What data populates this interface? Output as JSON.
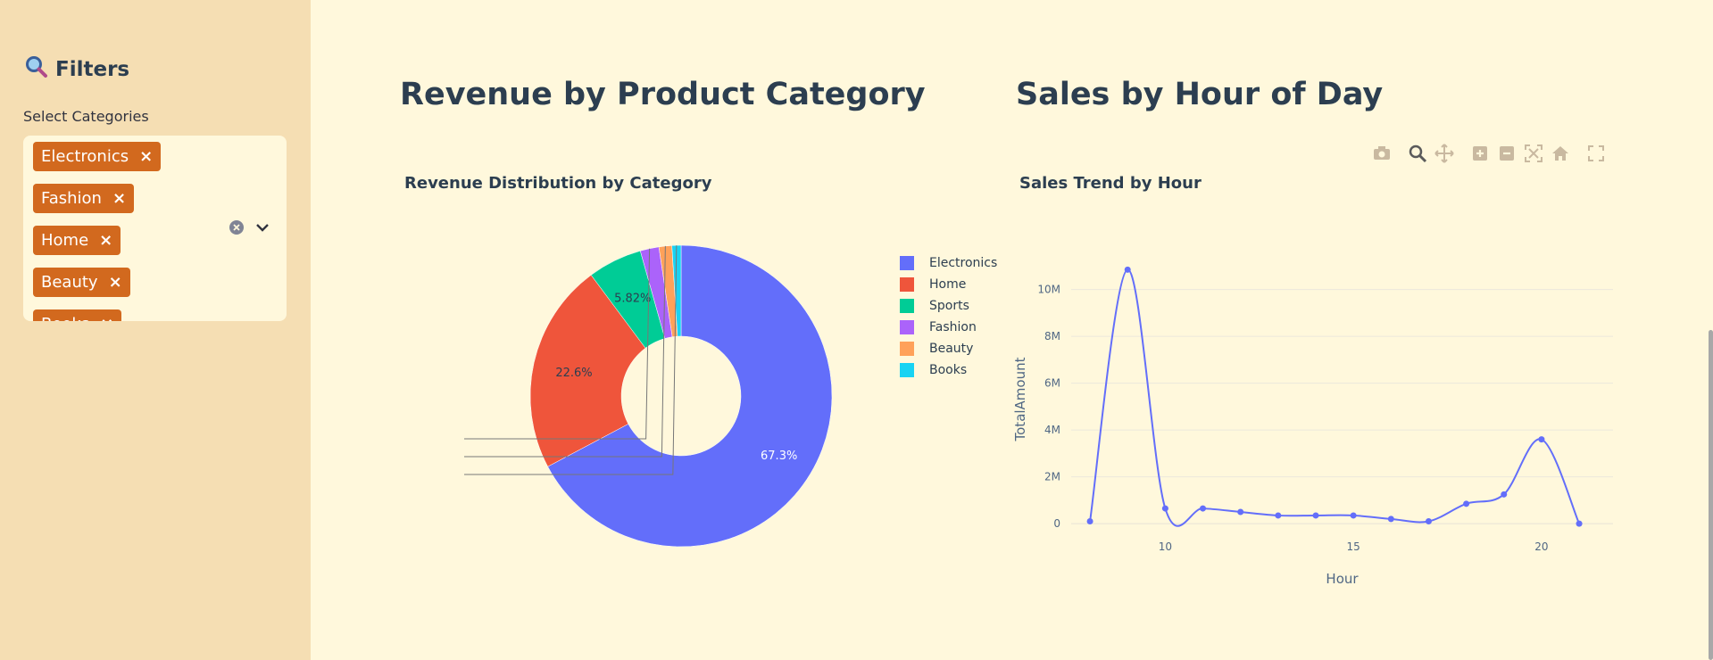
{
  "sidebar": {
    "title": "Filters",
    "select_label": "Select Categories",
    "selected_tags": [
      "Electronics",
      "Fashion",
      "Home",
      "Beauty",
      "Books"
    ],
    "remove_glyph": "×"
  },
  "main": {
    "left_title": "Revenue by Product Category",
    "right_title": "Sales by Hour of Day"
  },
  "icons": {
    "filters": "magnifying-glass-icon",
    "clear": "clear-icon",
    "dropdown": "chevron-down-icon"
  },
  "chart_data": [
    {
      "type": "pie",
      "title": "Revenue Distribution by Category",
      "hole": true,
      "categories": [
        "Electronics",
        "Home",
        "Sports",
        "Fashion",
        "Beauty",
        "Books"
      ],
      "values": [
        67.3,
        22.6,
        5.82,
        2.01,
        1.38,
        0.974
      ],
      "labels": [
        "67.3%",
        "22.6%",
        "5.82%",
        "2.01%",
        "1.38%",
        "0.974%"
      ],
      "colors": [
        "#636efa",
        "#ef553b",
        "#00cc96",
        "#ab63fa",
        "#ffa15a",
        "#19d3f3"
      ],
      "legend": "right"
    },
    {
      "type": "line",
      "title": "Sales Trend by Hour",
      "xlabel": "Hour",
      "ylabel": "TotalAmount",
      "x": [
        8,
        9,
        10,
        11,
        12,
        13,
        14,
        15,
        16,
        17,
        18,
        19,
        20,
        21
      ],
      "y": [
        100000,
        10850000,
        650000,
        650000,
        500000,
        350000,
        350000,
        350000,
        200000,
        100000,
        850000,
        1250000,
        3600000,
        0
      ],
      "xticks": [
        "10",
        "15",
        "20"
      ],
      "yticks": [
        "0",
        "2M",
        "4M",
        "6M",
        "8M",
        "10M"
      ],
      "xlim": [
        7.5,
        21.9
      ],
      "ylim": [
        -300000,
        11700000
      ],
      "line_shape": "spline",
      "color": "#636efa",
      "grid": true
    }
  ]
}
